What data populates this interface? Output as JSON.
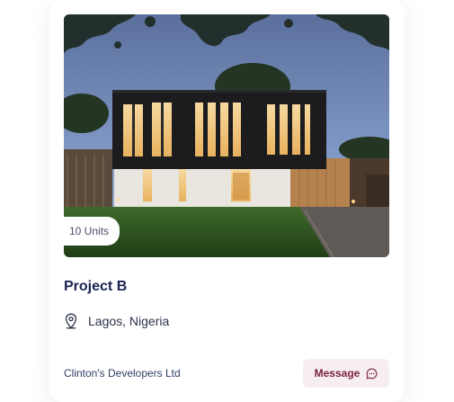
{
  "listing": {
    "units_badge": "10 Units",
    "title": "Project B",
    "location": "Lagos, Nigeria",
    "developer": "Clinton's Developers Ltd",
    "message_label": "Message"
  },
  "icons": {
    "location": "map-pin-icon",
    "message": "chat-bubble-icon"
  },
  "colors": {
    "title": "#1b2250",
    "accent": "#7a1f3d",
    "button_bg": "#f7eef0"
  }
}
